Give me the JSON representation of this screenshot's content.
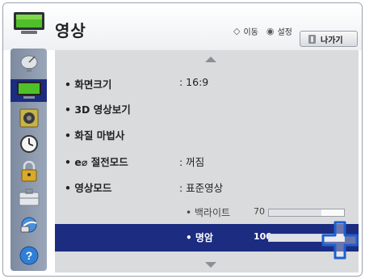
{
  "header": {
    "title": "영상",
    "hint_move_symbol": "◇",
    "hint_move": "이동",
    "hint_select_symbol": "◉",
    "hint_select": "설정",
    "exit_label": "나가기"
  },
  "sidebar": {
    "items": [
      {
        "icon": "satellite-dish-icon"
      },
      {
        "icon": "tv-picture-icon",
        "active": true
      },
      {
        "icon": "speaker-icon"
      },
      {
        "icon": "clock-icon"
      },
      {
        "icon": "lock-icon"
      },
      {
        "icon": "options-toolbox-icon"
      },
      {
        "icon": "network-globe-icon"
      },
      {
        "icon": "help-question-icon"
      }
    ]
  },
  "menu": {
    "items": [
      {
        "label": "• 화면크기",
        "value": ": 16:9"
      },
      {
        "label": "• 3D 영상보기",
        "value": ""
      },
      {
        "label": "• 화질 마법사",
        "value": ""
      },
      {
        "label": "• e⌀ 절전모드",
        "value": ": 꺼짐"
      },
      {
        "label": "• 영상모드",
        "value": ": 표준영상"
      }
    ],
    "sub_items": [
      {
        "label": "• 백라이트",
        "value": "70",
        "level": 70
      },
      {
        "label": "• 명암",
        "value": "100",
        "level": 100,
        "selected": true
      }
    ]
  },
  "colors": {
    "highlight": "#1c2c80",
    "pointer": "#1e5fd0"
  }
}
